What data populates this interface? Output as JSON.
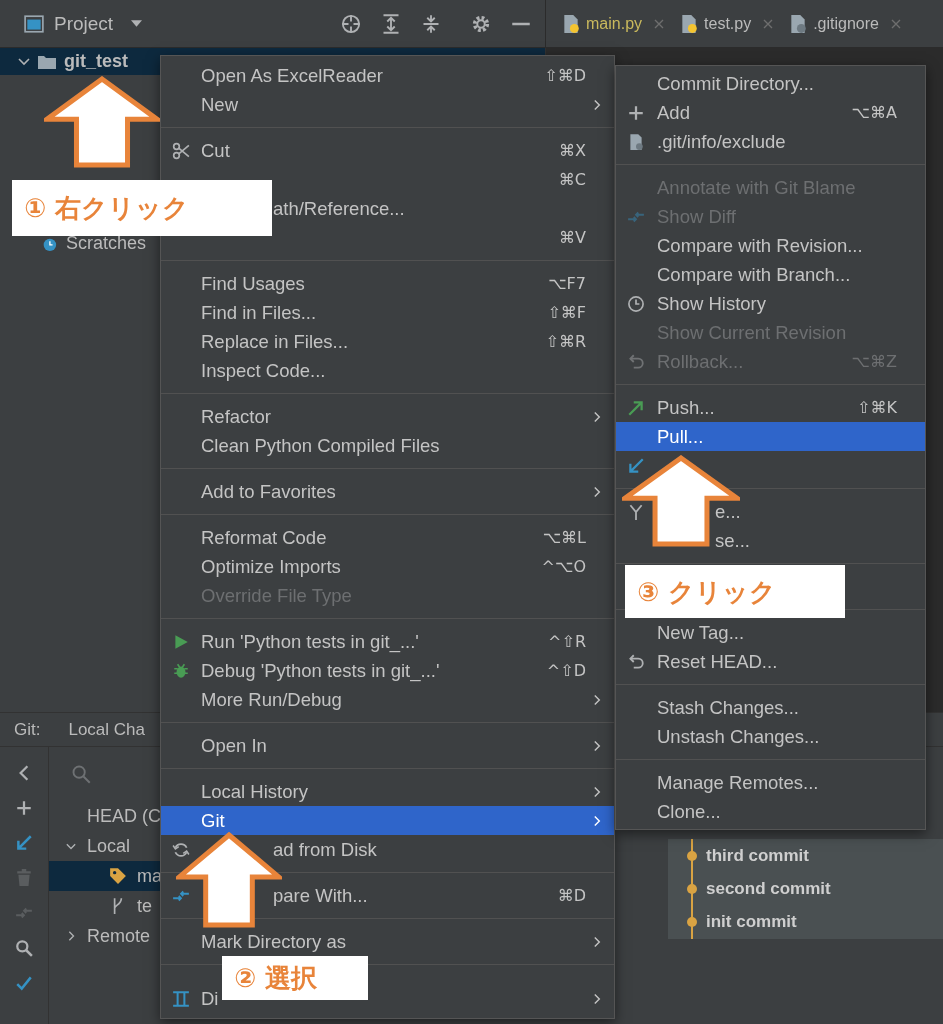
{
  "toolbar": {
    "view": "Project"
  },
  "tabs": [
    {
      "label": "main.py",
      "color": "#c9b95d"
    },
    {
      "label": "test.py",
      "color": "#bbbbbb"
    },
    {
      "label": ".gitignore",
      "color": "#bbbbbb"
    }
  ],
  "project_tree": [
    {
      "label": "git_test",
      "kind": "folder",
      "selected": true
    },
    {
      "label": "Scratches",
      "kind": "scratches",
      "selected": false
    }
  ],
  "git_panel": {
    "title": "Git:",
    "tab": "Local Cha",
    "branches": [
      {
        "label": "HEAD (C",
        "kind": "head",
        "selected": false
      },
      {
        "label": "Local",
        "kind": "group",
        "expanded": true,
        "selected": false,
        "children": [
          {
            "label": "ma",
            "kind": "tag",
            "selected": true
          },
          {
            "label": "te",
            "kind": "branch",
            "selected": false
          }
        ]
      },
      {
        "label": "Remote",
        "kind": "group",
        "expanded": false,
        "selected": false
      }
    ],
    "commits": [
      "third commit",
      "second commit",
      "init commit"
    ]
  },
  "context_menu": {
    "items": [
      {
        "kind": "item",
        "label": "Open As ExcelReader",
        "shortcut": "⇧⌘D",
        "selected": false,
        "disabled": false,
        "covered": false
      },
      {
        "kind": "item",
        "label": "New",
        "submenu": true,
        "selected": false,
        "disabled": false,
        "covered": false
      },
      {
        "kind": "separator"
      },
      {
        "kind": "cut",
        "label": "Cut",
        "shortcut": "⌘X",
        "selected": false,
        "disabled": false,
        "covered": false
      },
      {
        "kind": "item",
        "shortcut": "⌘C",
        "selected": false,
        "disabled": false
      },
      {
        "kind": "item",
        "label": "ath/Reference...",
        "selected": false,
        "disabled": false,
        "covered": true
      },
      {
        "kind": "item",
        "shortcut": "⌘V",
        "selected": false,
        "disabled": false
      },
      {
        "kind": "separator"
      },
      {
        "kind": "item",
        "label": "Find Usages",
        "shortcut": "⌥F7",
        "selected": false,
        "disabled": false,
        "covered": false
      },
      {
        "kind": "item",
        "label": "Find in Files...",
        "shortcut": "⇧⌘F",
        "selected": false,
        "disabled": false,
        "covered": false
      },
      {
        "kind": "item",
        "label": "Replace in Files...",
        "shortcut": "⇧⌘R",
        "selected": false,
        "disabled": false,
        "covered": false
      },
      {
        "kind": "item",
        "label": "Inspect Code...",
        "selected": false,
        "disabled": false,
        "covered": false
      },
      {
        "kind": "separator"
      },
      {
        "kind": "item",
        "label": "Refactor",
        "submenu": true,
        "selected": false,
        "disabled": false,
        "covered": false
      },
      {
        "kind": "item",
        "label": "Clean Python Compiled Files",
        "selected": false,
        "disabled": false,
        "covered": false
      },
      {
        "kind": "separator"
      },
      {
        "kind": "item",
        "label": "Add to Favorites",
        "submenu": true,
        "selected": false,
        "disabled": false,
        "covered": false
      },
      {
        "kind": "separator"
      },
      {
        "kind": "item",
        "label": "Reformat Code",
        "shortcut": "⌥⌘L",
        "selected": false,
        "disabled": false,
        "covered": false
      },
      {
        "kind": "item",
        "label": "Optimize Imports",
        "shortcut": "^⌥O",
        "selected": false,
        "disabled": false,
        "covered": false
      },
      {
        "kind": "item",
        "label": "Override File Type",
        "selected": false,
        "disabled": true,
        "covered": false
      },
      {
        "kind": "separator"
      },
      {
        "kind": "run",
        "label": "Run 'Python tests in git_...'",
        "shortcut": "^⇧R",
        "selected": false,
        "disabled": false,
        "covered": false
      },
      {
        "kind": "debug",
        "label": "Debug 'Python tests in git_...'",
        "shortcut": "^⇧D",
        "selected": false,
        "disabled": false,
        "covered": false
      },
      {
        "kind": "item",
        "label": "More Run/Debug",
        "submenu": true,
        "selected": false,
        "disabled": false,
        "covered": false
      },
      {
        "kind": "separator"
      },
      {
        "kind": "item",
        "label": "Open In",
        "submenu": true,
        "selected": false,
        "disabled": false,
        "covered": false
      },
      {
        "kind": "separator"
      },
      {
        "kind": "item",
        "label": "Local History",
        "submenu": true,
        "selected": false,
        "disabled": false,
        "covered": false
      },
      {
        "kind": "item",
        "label": "Git",
        "submenu": true,
        "selected": true,
        "disabled": false,
        "covered": false
      },
      {
        "kind": "reload",
        "label": "ad from Disk",
        "selected": false,
        "disabled": false,
        "covered": true
      },
      {
        "kind": "separator"
      },
      {
        "kind": "compare",
        "label": "pare With...",
        "shortcut": "⌘D",
        "selected": false,
        "disabled": false,
        "covered": true
      },
      {
        "kind": "separator"
      },
      {
        "kind": "item",
        "label": "Mark Directory as",
        "submenu": true,
        "selected": false,
        "disabled": false,
        "covered": false
      },
      {
        "kind": "separator"
      },
      {
        "kind": "diagram",
        "label": "Di",
        "submenu": true,
        "selected": false,
        "disabled": false,
        "covered": false
      }
    ]
  },
  "git_submenu": {
    "items": [
      {
        "kind": "item",
        "label": "Commit Directory...",
        "selected": false,
        "disabled": false,
        "covered": false
      },
      {
        "kind": "add",
        "label": "Add",
        "shortcut": "⌥⌘A",
        "selected": false,
        "disabled": false,
        "covered": false
      },
      {
        "kind": "file",
        "label": ".git/info/exclude",
        "selected": false,
        "disabled": false,
        "covered": false
      },
      {
        "kind": "separator"
      },
      {
        "kind": "item",
        "label": "Annotate with Git Blame",
        "selected": false,
        "disabled": true,
        "covered": false
      },
      {
        "kind": "diff",
        "label": "Show Diff",
        "selected": false,
        "disabled": true,
        "covered": false
      },
      {
        "kind": "item",
        "label": "Compare with Revision...",
        "selected": false,
        "disabled": false,
        "covered": false
      },
      {
        "kind": "item",
        "label": "Compare with Branch...",
        "selected": false,
        "disabled": false,
        "covered": false
      },
      {
        "kind": "history",
        "label": "Show History",
        "selected": false,
        "disabled": false,
        "covered": false
      },
      {
        "kind": "item",
        "label": "Show Current Revision",
        "selected": false,
        "disabled": true,
        "covered": false
      },
      {
        "kind": "rollback",
        "label": "Rollback...",
        "shortcut": "⌥⌘Z",
        "selected": false,
        "disabled": true,
        "covered": false
      },
      {
        "kind": "separator"
      },
      {
        "kind": "push",
        "label": "Push...",
        "shortcut": "⇧⌘K",
        "selected": false,
        "disabled": false,
        "covered": false
      },
      {
        "kind": "item",
        "label": "Pull...",
        "selected": true,
        "disabled": false,
        "covered": false
      },
      {
        "kind": "fetch",
        "selected": false,
        "disabled": false
      },
      {
        "kind": "separator"
      },
      {
        "kind": "merge",
        "label": "e...",
        "selected": false,
        "disabled": false,
        "covered": true
      },
      {
        "kind": "item",
        "label": "se...",
        "selected": false,
        "disabled": false,
        "covered": true
      },
      {
        "kind": "separator"
      },
      {
        "kind": "gap"
      },
      {
        "kind": "separator"
      },
      {
        "kind": "item",
        "label": "New Tag...",
        "selected": false,
        "disabled": false,
        "covered": false
      },
      {
        "kind": "reset",
        "label": "Reset HEAD...",
        "selected": false,
        "disabled": false,
        "covered": false
      },
      {
        "kind": "separator"
      },
      {
        "kind": "item",
        "label": "Stash Changes...",
        "selected": false,
        "disabled": false,
        "covered": false
      },
      {
        "kind": "item",
        "label": "Unstash Changes...",
        "selected": false,
        "disabled": false,
        "covered": false
      },
      {
        "kind": "separator"
      },
      {
        "kind": "item",
        "label": "Manage Remotes...",
        "selected": false,
        "disabled": false,
        "covered": false
      },
      {
        "kind": "item",
        "label": "Clone...",
        "selected": false,
        "disabled": false,
        "covered": false
      }
    ]
  },
  "annotations": [
    {
      "label": "① 右クリック"
    },
    {
      "label": "② 選択"
    },
    {
      "label": "③ クリック"
    }
  ]
}
